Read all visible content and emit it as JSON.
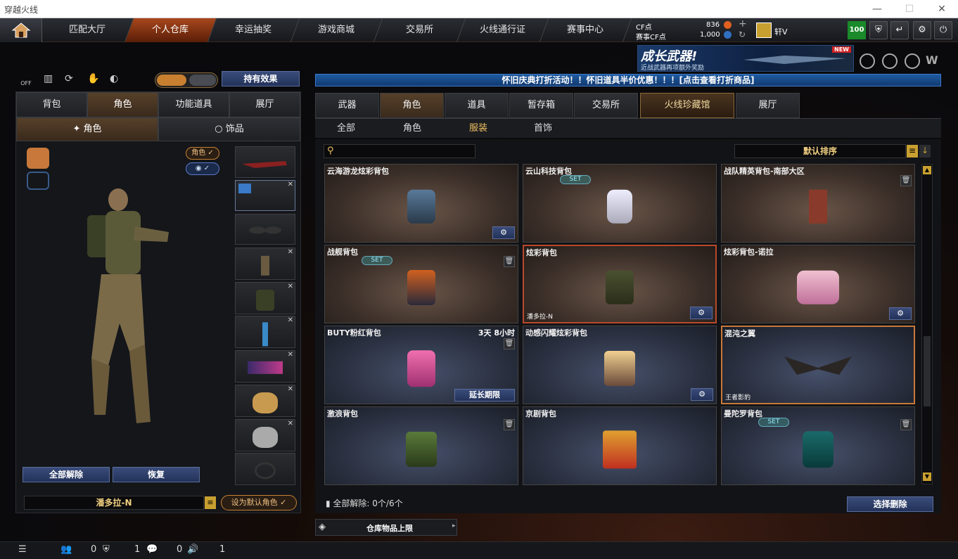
{
  "window": {
    "title": "穿越火线",
    "min": "—",
    "max": "☐",
    "close": "✕"
  },
  "nav": {
    "tabs": [
      "匹配大厅",
      "个人仓库",
      "幸运抽奖",
      "游戏商城",
      "交易所",
      "火线通行证",
      "赛事中心"
    ]
  },
  "currency": {
    "cf_label": "CF点",
    "cf_value": "836",
    "match_label": "赛事CF点",
    "match_value": "1,000",
    "user": "轩V",
    "badge": "100",
    "add": "+",
    "refresh": "↻"
  },
  "ad": {
    "title": "成长武器!",
    "subtitle": "近战武器再项额外奖励",
    "new": "NEW"
  },
  "left": {
    "effect_btn": "持有效果",
    "off": "OFF",
    "tabs": [
      "背包",
      "角色",
      "功能道具",
      "展厅"
    ],
    "subtabs": [
      "角色",
      "饰品"
    ],
    "pill_char": "角色",
    "check": "✓",
    "clear_all": "全部解除",
    "restore": "恢复",
    "char_name": "潘多拉-N",
    "set_default": "设为默认角色"
  },
  "right": {
    "banner": "怀旧庆典打折活动！！怀旧道具半价优惠！！！[点击查看打折商品]",
    "tabs": [
      "武器",
      "角色",
      "道具",
      "暂存箱",
      "交易所",
      "火线珍藏馆",
      "展厅"
    ],
    "subtabs": [
      "全部",
      "角色",
      "服装",
      "首饰"
    ],
    "sort": "默认排序",
    "set": "SET",
    "items": [
      {
        "name": "云海游龙炫彩背包",
        "tag": "",
        "time": ""
      },
      {
        "name": "云山科技背包",
        "tag": "",
        "time": ""
      },
      {
        "name": "战队精英背包-南部大区",
        "tag": "",
        "time": ""
      },
      {
        "name": "战舰背包",
        "tag": "",
        "time": ""
      },
      {
        "name": "炫彩背包",
        "tag": "潘多拉-N",
        "time": ""
      },
      {
        "name": "炫彩背包-诺拉",
        "tag": "",
        "time": ""
      },
      {
        "name": "BUTY粉红背包",
        "tag": "",
        "time": "3天 8小时"
      },
      {
        "name": "动感闪耀炫彩背包",
        "tag": "",
        "time": ""
      },
      {
        "name": "混沌之翼",
        "tag": "王者影豹",
        "time": ""
      },
      {
        "name": "激浪背包",
        "tag": "",
        "time": ""
      },
      {
        "name": "京剧背包",
        "tag": "",
        "time": ""
      },
      {
        "name": "曼陀罗背包",
        "tag": "",
        "time": ""
      }
    ],
    "extend": "延长期限",
    "clear_label": "全部解除:",
    "clear_count": "0个/6个",
    "select_delete": "选择删除",
    "storage_limit": "仓库物品上限"
  },
  "status": {
    "v1": "0",
    "v2": "1",
    "v3": "0",
    "v4": "1"
  }
}
